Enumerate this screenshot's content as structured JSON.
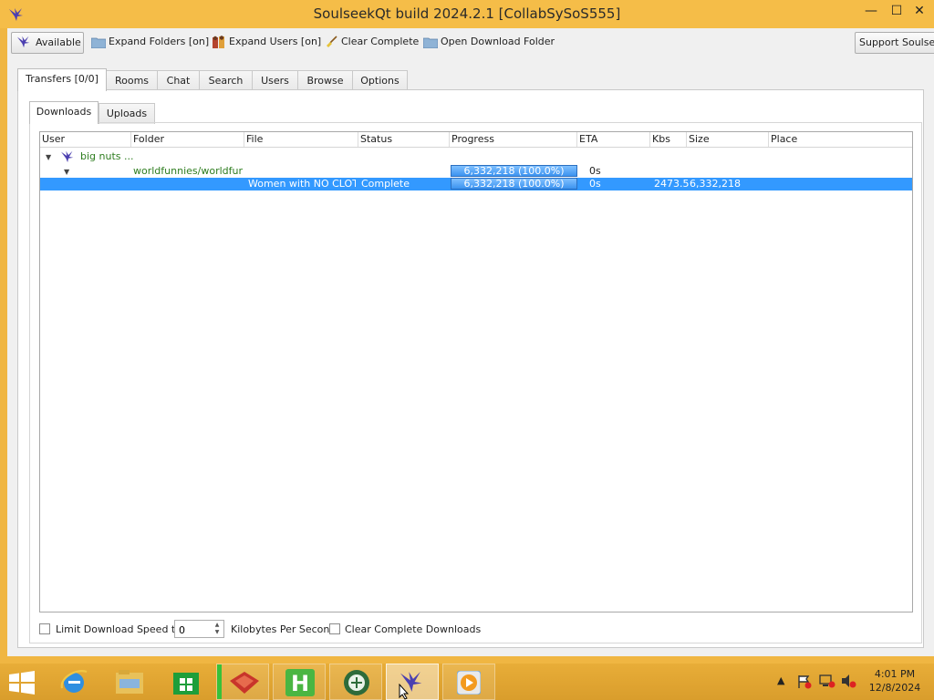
{
  "window": {
    "title": "SoulseekQt build 2024.2.1 [CollabSySoS555]",
    "min_glyph": "—",
    "max_glyph": "☐",
    "close_glyph": "✕"
  },
  "toolbar": {
    "available": "Available",
    "expand_folders": "Expand Folders [on]",
    "expand_users": "Expand Users [on]",
    "clear_complete": "Clear Complete",
    "open_download_folder": "Open Download Folder",
    "support": "Support Soulseek"
  },
  "tabs": [
    "Transfers [0/0]",
    "Rooms",
    "Chat",
    "Search",
    "Users",
    "Browse",
    "Options"
  ],
  "subtabs": [
    "Downloads",
    "Uploads"
  ],
  "columns": [
    "User",
    "Folder",
    "File",
    "Status",
    "Progress",
    "ETA",
    "Kbs",
    "Size",
    "Place"
  ],
  "rows": {
    "user": {
      "name": "big nuts ..."
    },
    "folder": {
      "folder": "worldfunnies/worldfun...",
      "progress": "6,332,218 (100.0%)",
      "progress_fraction": 1.0,
      "eta": "0s"
    },
    "file": {
      "file": "Women with NO CLOT...",
      "status": "Complete",
      "progress": "6,332,218 (100.0%)",
      "progress_fraction": 1.0,
      "eta": "0s",
      "kbs": "2473.5",
      "size": "6,332,218"
    }
  },
  "bottom": {
    "limit_label": "Limit Download Speed to",
    "limit_value": "0",
    "unit_label": "Kilobytes Per Second",
    "clear_label": "Clear Complete Downloads"
  },
  "taskbar": {
    "clock_time": "4:01 PM",
    "clock_date": "12/8/2024"
  },
  "colors": {
    "window_frame": "#f5bd48",
    "selection": "#3399ff",
    "progress": "#4a9cf2",
    "green_text": "#2e7d1f"
  }
}
